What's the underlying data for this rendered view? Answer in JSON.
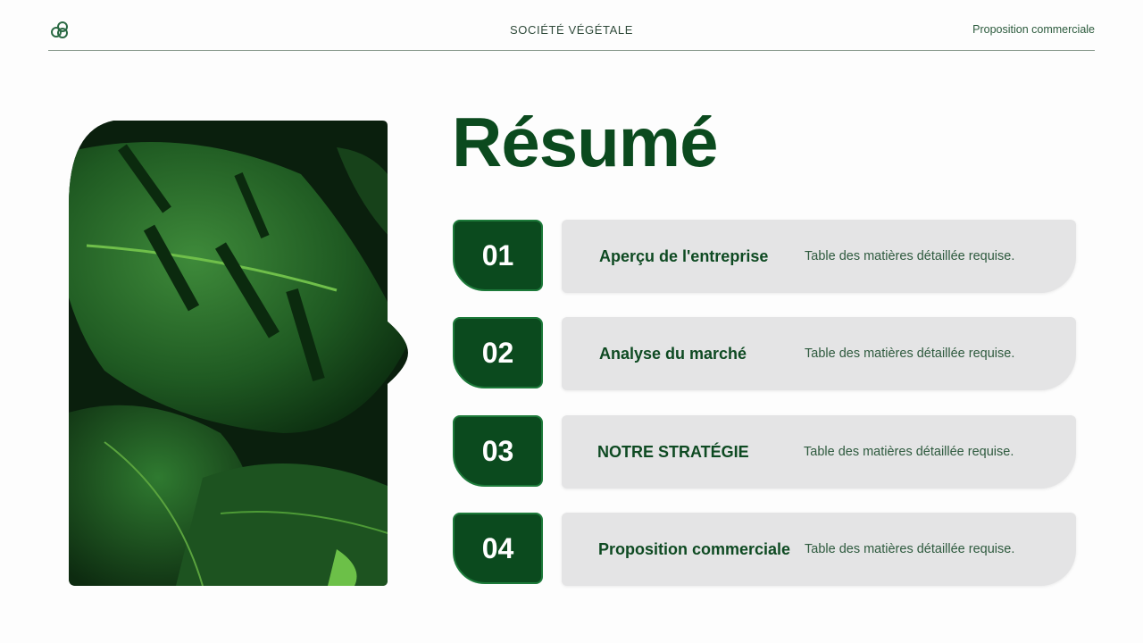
{
  "header": {
    "brand": "SOCIÉTÉ VÉGÉTALE",
    "right_label": "Proposition commerciale",
    "logo_icon": "overlapping-circles-logo-icon"
  },
  "main": {
    "title": "Résumé",
    "image": "monstera-leaves-photo",
    "items": [
      {
        "number": "01",
        "title": "Aperçu de l'entreprise",
        "description": "Table des matières détaillée requise."
      },
      {
        "number": "02",
        "title": "Analyse du marché",
        "description": "Table des matières détaillée requise."
      },
      {
        "number": "03",
        "title": "NOTRE STRATÉGIE",
        "description": "Table des matières détaillée requise."
      },
      {
        "number": "04",
        "title": "Proposition commerciale",
        "description": "Table des matières détaillée requise."
      }
    ]
  },
  "colors": {
    "primary_green": "#0b4a1e",
    "pill_gray": "#e4e4e5",
    "text_green": "#2e5a3e"
  }
}
